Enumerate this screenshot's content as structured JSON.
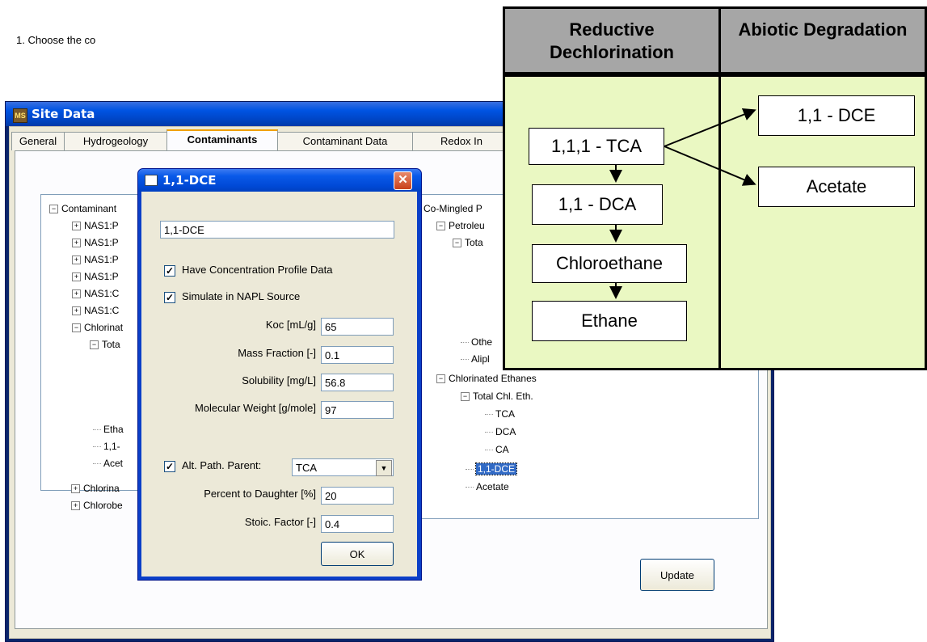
{
  "site_window": {
    "title": "Site Data",
    "icon_label": "MS",
    "tabs": [
      "General",
      "Hydrogeology",
      "Contaminants",
      "Contaminant Data",
      "Redox In"
    ],
    "active_tab": "Contaminants",
    "instruction": "1. Choose the co",
    "left_tree": [
      {
        "text": "Contaminant",
        "toggle": "−",
        "level": 0
      },
      {
        "text": "NAS1:P",
        "toggle": "+",
        "level": 1
      },
      {
        "text": "NAS1:P",
        "toggle": "+",
        "level": 1
      },
      {
        "text": "NAS1:P",
        "toggle": "+",
        "level": 1
      },
      {
        "text": "NAS1:P",
        "toggle": "+",
        "level": 1
      },
      {
        "text": "NAS1:C",
        "toggle": "+",
        "level": 1
      },
      {
        "text": "NAS1:C",
        "toggle": "+",
        "level": 1
      },
      {
        "text": "Chlorinat",
        "toggle": "−",
        "level": 1
      },
      {
        "text": "Tota",
        "toggle": "−",
        "level": 2
      },
      {
        "text": "Etha",
        "toggle": "",
        "level": 2
      },
      {
        "text": "1,1-",
        "toggle": "",
        "level": 2
      },
      {
        "text": "Acet",
        "toggle": "",
        "level": 2
      },
      {
        "text": "Chlorina",
        "toggle": "+",
        "level": 1
      },
      {
        "text": "Chlorobe",
        "toggle": "+",
        "level": 1
      }
    ],
    "right_tree": [
      {
        "text": "Co-Mingled P",
        "toggle": "",
        "level": 0
      },
      {
        "text": "Petroleu",
        "toggle": "−",
        "level": 1
      },
      {
        "text": "Tota",
        "toggle": "−",
        "level": 2
      },
      {
        "text": "Othe",
        "toggle": "",
        "level": 2
      },
      {
        "text": "Alipl",
        "toggle": "",
        "level": 2
      },
      {
        "text": "Chlorinated Ethanes",
        "toggle": "−",
        "level": 1
      },
      {
        "text": "Total Chl. Eth.",
        "toggle": "−",
        "level": 2
      },
      {
        "text": "TCA",
        "toggle": "",
        "level": 3
      },
      {
        "text": "DCA",
        "toggle": "",
        "level": 3
      },
      {
        "text": "CA",
        "toggle": "",
        "level": 3
      },
      {
        "text": "1,1-DCE",
        "toggle": "",
        "level": 2,
        "selected": true
      },
      {
        "text": "Acetate",
        "toggle": "",
        "level": 2
      }
    ],
    "update_label": "Update"
  },
  "dialog": {
    "title": "1,1-DCE",
    "name_value": "1,1-DCE",
    "have_profile_label": "Have Concentration Profile Data",
    "have_profile_checked": true,
    "simulate_napl_label": "Simulate in NAPL Source",
    "simulate_napl_checked": true,
    "koc_label": "Koc [mL/g]",
    "koc_value": "65",
    "mass_fraction_label": "Mass Fraction [-]",
    "mass_fraction_value": "0.1",
    "solubility_label": "Solubility [mg/L]",
    "solubility_value": "56.8",
    "mw_label": "Molecular Weight [g/mole]",
    "mw_value": "97",
    "alt_path_label": "Alt. Path. Parent:",
    "alt_path_checked": true,
    "alt_path_value": "TCA",
    "percent_label": "Percent to Daughter [%]",
    "percent_value": "20",
    "stoic_label": "Stoic. Factor [-]",
    "stoic_value": "0.4",
    "ok_label": "OK"
  },
  "diagram": {
    "reductive_header": "Reductive Dechlorination",
    "abiotic_header": "Abiotic Degradation",
    "reductive_nodes": [
      "1,1,1 - TCA",
      "1,1 - DCA",
      "Chloroethane",
      "Ethane"
    ],
    "abiotic_nodes": [
      "1,1 - DCE",
      "Acetate"
    ]
  }
}
